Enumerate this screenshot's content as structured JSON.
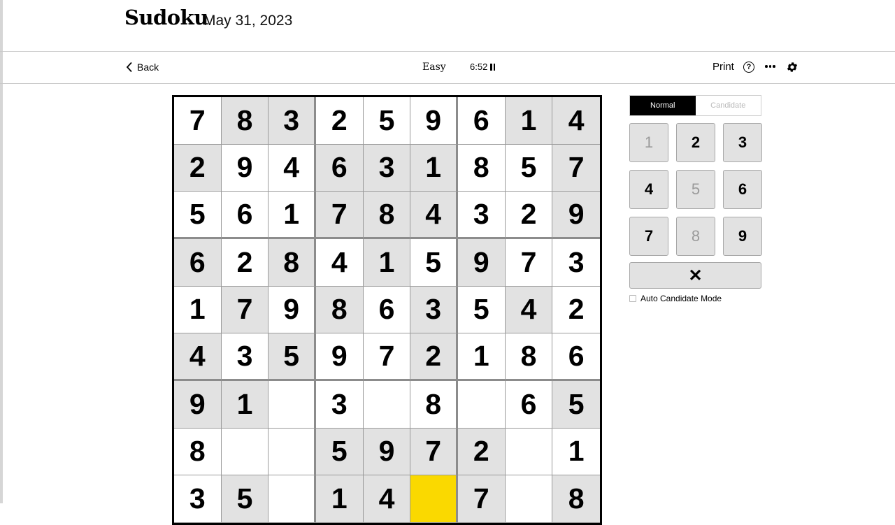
{
  "header": {
    "logo": "Sudoku",
    "date": "May 31, 2023"
  },
  "toolbar": {
    "back_label": "Back",
    "difficulty": "Easy",
    "timer": "6:52",
    "print_label": "Print",
    "help_symbol": "?"
  },
  "icons": {
    "back": "chevron-left-icon",
    "pause": "pause-icon",
    "help": "question-circle-icon",
    "more": "ellipsis-icon",
    "settings": "gear-icon",
    "erase": "close-icon"
  },
  "colors": {
    "selected_cell": "#fad900",
    "shaded_cell": "#e2e2e2",
    "active_mode": "#000000"
  },
  "board": {
    "rows": [
      [
        "7",
        "8",
        "3",
        "2",
        "5",
        "9",
        "6",
        "1",
        "4"
      ],
      [
        "2",
        "9",
        "4",
        "6",
        "3",
        "1",
        "8",
        "5",
        "7"
      ],
      [
        "5",
        "6",
        "1",
        "7",
        "8",
        "4",
        "3",
        "2",
        "9"
      ],
      [
        "6",
        "2",
        "8",
        "4",
        "1",
        "5",
        "9",
        "7",
        "3"
      ],
      [
        "1",
        "7",
        "9",
        "8",
        "6",
        "3",
        "5",
        "4",
        "2"
      ],
      [
        "4",
        "3",
        "5",
        "9",
        "7",
        "2",
        "1",
        "8",
        "6"
      ],
      [
        "9",
        "1",
        "",
        "3",
        "",
        "8",
        "",
        "6",
        "5"
      ],
      [
        "8",
        "",
        "",
        "5",
        "9",
        "7",
        "2",
        "",
        "1"
      ],
      [
        "3",
        "5",
        "",
        "1",
        "4",
        "",
        "7",
        "",
        "8"
      ]
    ],
    "shaded": [
      [
        0,
        1,
        1,
        0,
        0,
        0,
        0,
        1,
        1
      ],
      [
        1,
        0,
        0,
        1,
        1,
        1,
        0,
        0,
        1
      ],
      [
        0,
        0,
        0,
        1,
        1,
        1,
        0,
        0,
        1
      ],
      [
        1,
        0,
        1,
        0,
        1,
        0,
        1,
        0,
        0
      ],
      [
        0,
        1,
        0,
        1,
        0,
        1,
        0,
        1,
        0
      ],
      [
        1,
        0,
        1,
        0,
        0,
        1,
        0,
        0,
        0
      ],
      [
        1,
        1,
        0,
        0,
        0,
        0,
        0,
        0,
        1
      ],
      [
        0,
        0,
        0,
        1,
        1,
        1,
        1,
        0,
        0
      ],
      [
        0,
        1,
        0,
        1,
        1,
        0,
        1,
        0,
        1
      ]
    ],
    "selected": [
      8,
      5
    ]
  },
  "mode": {
    "normal_label": "Normal",
    "candidate_label": "Candidate",
    "active": "normal"
  },
  "keypad": {
    "keys": [
      {
        "label": "1",
        "dim": true
      },
      {
        "label": "2",
        "dim": false
      },
      {
        "label": "3",
        "dim": false
      },
      {
        "label": "4",
        "dim": false
      },
      {
        "label": "5",
        "dim": true
      },
      {
        "label": "6",
        "dim": false
      },
      {
        "label": "7",
        "dim": false
      },
      {
        "label": "8",
        "dim": true
      },
      {
        "label": "9",
        "dim": false
      }
    ],
    "erase_symbol": "✕"
  },
  "options": {
    "auto_candidate_label": "Auto Candidate Mode",
    "auto_candidate_checked": false
  }
}
